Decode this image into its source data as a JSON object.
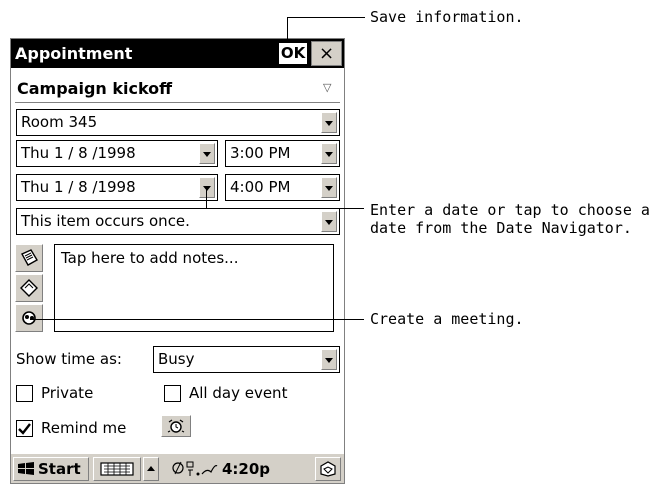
{
  "window": {
    "title": "Appointment",
    "ok_label": "OK",
    "close_label": "×"
  },
  "subject": "Campaign kickoff",
  "location": "Room 345",
  "start": {
    "date": "Thu   1 / 8 /1998",
    "time": "3:00 PM"
  },
  "end": {
    "date": "Thu   1 / 8 /1998",
    "time": "4:00 PM"
  },
  "recurrence": "This item occurs once.",
  "notes_placeholder": "Tap here to add notes...",
  "show_time_as": {
    "label": "Show time as:",
    "value": "Busy"
  },
  "checkboxes": {
    "private": {
      "label": "Private",
      "checked": false
    },
    "all_day": {
      "label": "All day event",
      "checked": false
    },
    "remind": {
      "label": "Remind me",
      "checked": true
    }
  },
  "taskbar": {
    "start_label": "Start",
    "clock": "4:20p"
  },
  "icons": [
    "notes-icon",
    "attendees-icon",
    "meeting-icon",
    "alarm-icon",
    "windows-flag-icon",
    "keyboard-icon",
    "connectivity-icon",
    "sip-icon"
  ],
  "callouts": {
    "save": "Save information.",
    "date_line1": "Enter a date or tap to choose a",
    "date_line2": "date from the Date Navigator.",
    "meeting": "Create a meeting."
  }
}
